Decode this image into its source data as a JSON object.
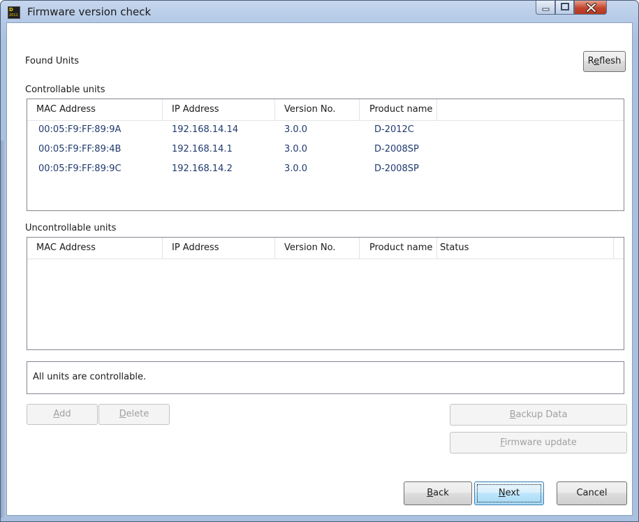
{
  "window": {
    "title": "Firmware version check",
    "app_icon_text": [
      "D",
      "2011"
    ]
  },
  "found_units_label": "Found Units",
  "refresh_button": {
    "prefix": "R",
    "accel": "e",
    "suffix": "flesh"
  },
  "controllable": {
    "label": "Controllable units",
    "columns": [
      "MAC Address",
      "IP Address",
      "Version No.",
      "Product name"
    ],
    "rows": [
      [
        "00:05:F9:FF:89:9A",
        "192.168.14.14",
        "3.0.0",
        "D-2012C"
      ],
      [
        "00:05:F9:FF:89:4B",
        "192.168.14.1",
        "3.0.0",
        "D-2008SP"
      ],
      [
        "00:05:F9:FF:89:9C",
        "192.168.14.2",
        "3.0.0",
        "D-2008SP"
      ]
    ]
  },
  "uncontrollable": {
    "label": "Uncontrollable units",
    "columns": [
      "MAC Address",
      "IP Address",
      "Version No.",
      "Product name",
      "Status"
    ],
    "rows": []
  },
  "status_message": "All units are controllable.",
  "buttons": {
    "add": {
      "accel": "A",
      "rest": "dd"
    },
    "delete": {
      "accel": "D",
      "rest": "elete"
    },
    "backup": {
      "accel": "B",
      "rest": "ackup Data"
    },
    "firmware": {
      "accel": "F",
      "rest": "irmware update"
    },
    "back": {
      "accel": "B",
      "rest": "ack"
    },
    "next": {
      "accel": "N",
      "rest": "ext"
    },
    "cancel": "Cancel"
  },
  "colors": {
    "titlebar": "#b4c9e6",
    "close_button": "#c4452d",
    "row_text": "#1f3a6e",
    "default_button": "#bee6fd"
  },
  "icons": [
    "minimize-icon",
    "maximize-icon",
    "close-icon",
    "app-logo-icon"
  ]
}
